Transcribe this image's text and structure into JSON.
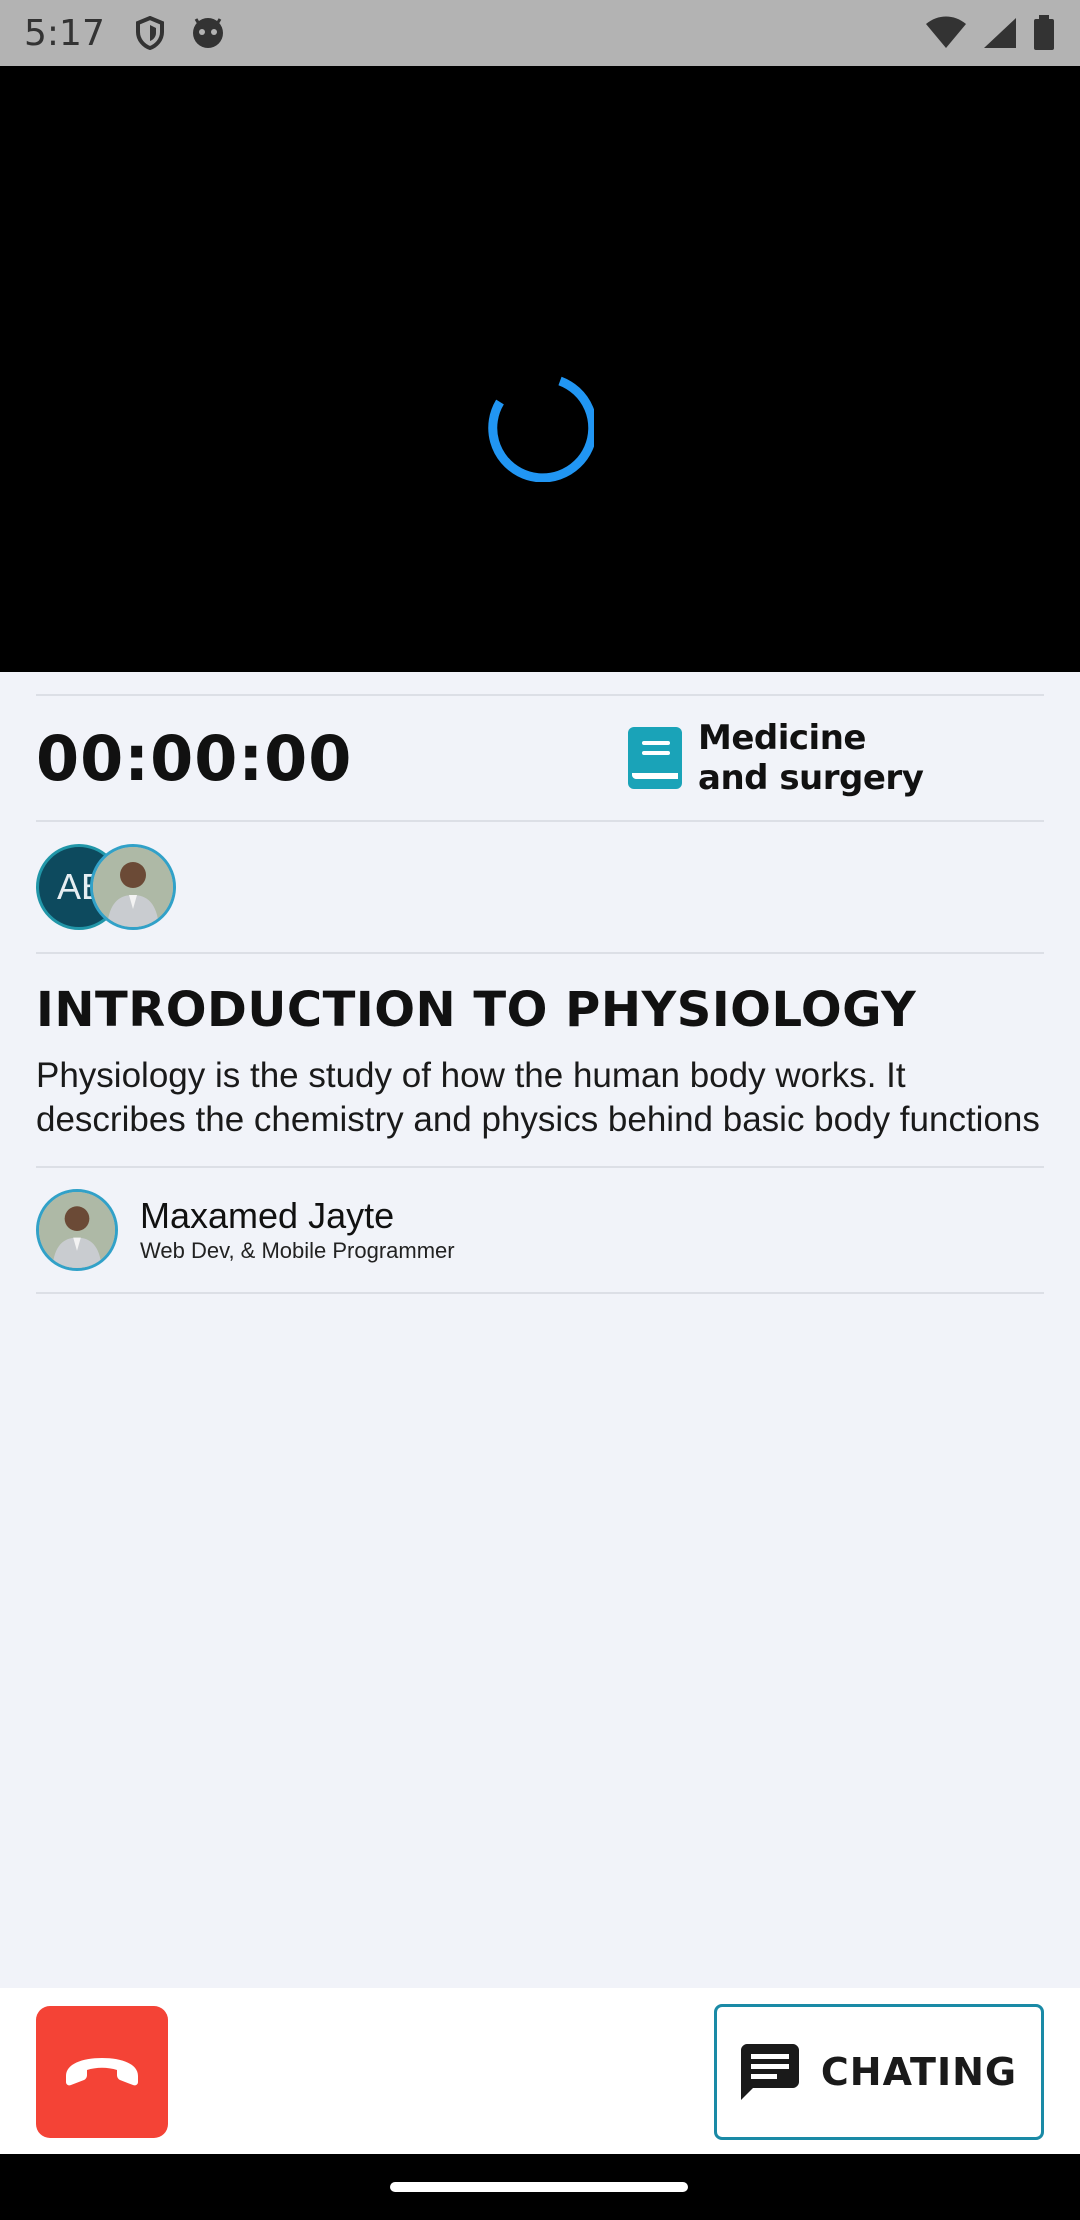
{
  "status_bar": {
    "time": "5:17",
    "icons": [
      "shield-icon",
      "android-face-icon",
      "wifi-icon",
      "signal-icon",
      "battery-icon"
    ]
  },
  "video": {
    "state": "loading",
    "spinner_color": "#2196f3"
  },
  "session": {
    "timer": "00:00:00",
    "subject_icon": "book-icon",
    "subject_label": "Medicine and surgery",
    "accent_color": "#1aa3b8"
  },
  "participants": [
    {
      "initials": "AB",
      "type": "initials",
      "color": "#0d4a5e"
    },
    {
      "type": "photo",
      "icon": "person-avatar"
    }
  ],
  "lesson": {
    "title": "INTRODUCTION TO PHYSIOLOGY",
    "description": "Physiology is the study of how the human body works. It describes the chemistry and physics behind basic body functions"
  },
  "instructor": {
    "name": "Maxamed Jayte",
    "role": "Web Dev, & Mobile Programmer"
  },
  "actions": {
    "end_call_icon": "phone-hangup-icon",
    "end_call_color": "#f44336",
    "chat_icon": "chat-icon",
    "chat_label": "CHATING",
    "chat_border_color": "#1a8aa6"
  }
}
